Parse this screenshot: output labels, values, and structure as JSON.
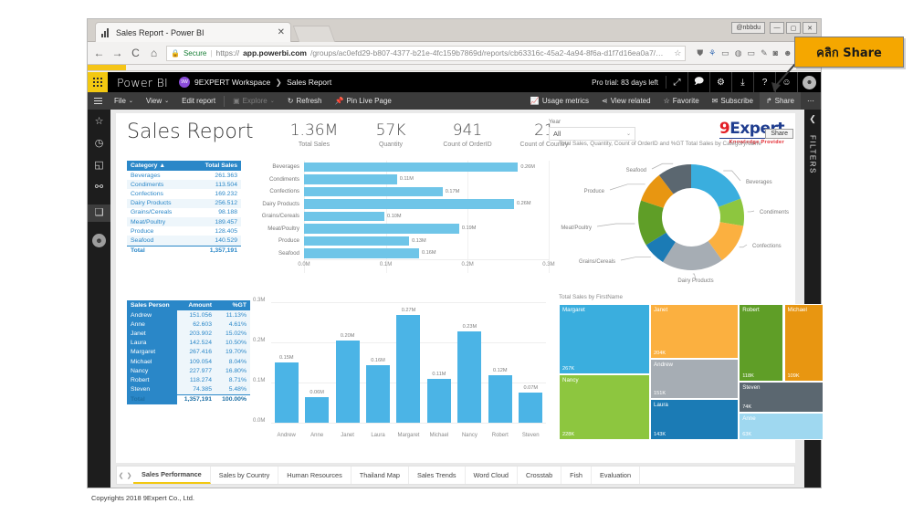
{
  "browser": {
    "tab_title": "Sales Report - Power BI",
    "tab_close": "✕",
    "nav": {
      "back": "←",
      "forward": "→",
      "reload": "C",
      "home": "⌂"
    },
    "secure_label": "Secure",
    "url_scheme": "https://",
    "url_host": "app.powerbi.com",
    "url_path": "/groups/ac0efd29-b807-4377-b21e-4fc159b7869d/reports/cb63316c-45a2-4a94-8f6a-d1f7d16ea0a7/ReportSe...",
    "star": "☆",
    "window_user": "@nbbdu",
    "win_min": "—",
    "win_max": "▢",
    "win_close": "✕"
  },
  "pbi_header": {
    "brand": "Power BI",
    "workspace_initials": "9W",
    "workspace": "9EXPERT Workspace",
    "separator": "❯",
    "report_name": "Sales Report",
    "trial_text": "Pro trial: 83 days left",
    "icons": {
      "expand": "⤢",
      "feedback": "🗩",
      "settings": "⚙",
      "download": "⤓",
      "help": "?",
      "smiley": "☺",
      "account": "◕"
    }
  },
  "command_bar": {
    "file": "File",
    "view": "View",
    "edit_report": "Edit report",
    "explore": "Explore",
    "refresh": "Refresh",
    "pin_live_page": "Pin Live Page",
    "usage_metrics": "Usage metrics",
    "view_related": "View related",
    "favorite": "Favorite",
    "subscribe": "Subscribe",
    "share": "Share",
    "more": "⋯",
    "caret": "⌄"
  },
  "left_rail": {
    "favorites_icon": "☆",
    "recent_icon": "◷",
    "apps_icon": "◱",
    "shared_icon": "⚯",
    "workspaces_icon": "❑",
    "avatar_icon": "☻"
  },
  "right_rail": {
    "collapse": "❮",
    "filters_label": "FILTERS"
  },
  "share_tooltip": "Share",
  "callout": {
    "text": "คลิก  Share"
  },
  "report": {
    "title": "Sales Report",
    "kpis": [
      {
        "value": "1.36M",
        "label": "Total Sales"
      },
      {
        "value": "57K",
        "label": "Quantity"
      },
      {
        "value": "941",
        "label": "Count of OrderID"
      },
      {
        "value": "21",
        "label": "Count of Country"
      }
    ],
    "slicer": {
      "label": "Year",
      "value": "All",
      "chevron": "⌄"
    },
    "logo": {
      "nine": "9",
      "expert": "Expert",
      "tagline": "Knowledge Provider"
    }
  },
  "category_table": {
    "sort_arrow": "▲",
    "headers": [
      "Category",
      "Total Sales"
    ],
    "rows": [
      [
        "Beverages",
        "261.363"
      ],
      [
        "Condiments",
        "113.504"
      ],
      [
        "Confections",
        "169.232"
      ],
      [
        "Dairy Products",
        "256.512"
      ],
      [
        "Grains/Cereals",
        "98.188"
      ],
      [
        "Meat/Poultry",
        "189.457"
      ],
      [
        "Produce",
        "128.405"
      ],
      [
        "Seafood",
        "140.529"
      ]
    ],
    "total": [
      "Total",
      "1,357,191"
    ]
  },
  "salesperson_table": {
    "headers": [
      "Sales Person",
      "Amount",
      "%GT"
    ],
    "rows": [
      [
        "Andrew",
        "151.056",
        "11.13%"
      ],
      [
        "Anne",
        "62.603",
        "4.61%"
      ],
      [
        "Janet",
        "203.902",
        "15.02%"
      ],
      [
        "Laura",
        "142.524",
        "10.50%"
      ],
      [
        "Margaret",
        "267.416",
        "19.70%"
      ],
      [
        "Michael",
        "109.054",
        "8.04%"
      ],
      [
        "Nancy",
        "227.977",
        "16.80%"
      ],
      [
        "Robert",
        "118.274",
        "8.71%"
      ],
      [
        "Steven",
        "74.385",
        "5.48%"
      ]
    ],
    "total": [
      "Total",
      "1,357,191",
      "100.00%"
    ]
  },
  "page_tabs": {
    "prev": "❮",
    "next": "❯",
    "items": [
      "Sales Performance",
      "Sales by Country",
      "Human Resources",
      "Thailand Map",
      "Sales Trends",
      "Word Cloud",
      "Crosstab",
      "Fish",
      "Evaluation"
    ],
    "active": "Sales Performance"
  },
  "copyright": "Copyrights 2018 9Expert Co., Ltd.",
  "chart_data": [
    {
      "type": "bar",
      "orientation": "horizontal",
      "title": "",
      "categories": [
        "Beverages",
        "Condiments",
        "Confections",
        "Dairy Products",
        "Grains/Cereals",
        "Meat/Poultry",
        "Produce",
        "Seafood"
      ],
      "values": [
        0.261363,
        0.113504,
        0.169232,
        0.256512,
        0.098188,
        0.189457,
        0.128405,
        0.140529
      ],
      "data_labels": [
        "0.26M",
        "0.11M",
        "0.17M",
        "0.26M",
        "0.10M",
        "0.19M",
        "0.13M",
        "0.16M"
      ],
      "xlabel": "",
      "ylabel": "",
      "xticks": [
        "0.0M",
        "0.1M",
        "0.2M",
        "0.3M"
      ],
      "xlim": [
        0,
        0.3
      ],
      "grid": true,
      "color": "#6fc5e8"
    },
    {
      "type": "pie",
      "subtype": "donut",
      "title": "Total Sales, Quantity, Count of OrderID and %GT Total Sales by CategoryName",
      "labels": [
        "Beverages",
        "Condiments",
        "Confections",
        "Dairy Products",
        "Grains/Cereals",
        "Meat/Poultry",
        "Produce",
        "Seafood"
      ],
      "values": [
        261363,
        113504,
        169232,
        256512,
        98188,
        189457,
        128405,
        140529
      ],
      "colors": [
        "#3aaede",
        "#8dc63f",
        "#fbb040",
        "#a6adb4",
        "#1b7bb5",
        "#5f9e27",
        "#e89611",
        "#5b6770"
      ],
      "legend": "labels-with-leader-lines"
    },
    {
      "type": "bar",
      "orientation": "vertical",
      "title": "",
      "categories": [
        "Andrew",
        "Anne",
        "Janet",
        "Laura",
        "Margaret",
        "Michael",
        "Nancy",
        "Robert",
        "Steven"
      ],
      "values": [
        0.151056,
        0.062603,
        0.203902,
        0.142524,
        0.267416,
        0.109054,
        0.227977,
        0.118274,
        0.074385
      ],
      "data_labels": [
        "0.15M",
        "0.06M",
        "0.20M",
        "0.16M",
        "0.27M",
        "0.11M",
        "0.23M",
        "0.12M",
        "0.07M"
      ],
      "yticks": [
        "0.0M",
        "0.1M",
        "0.2M",
        "0.3M"
      ],
      "ylim": [
        0,
        0.3
      ],
      "grid": true,
      "color": "#4bb4e6"
    },
    {
      "type": "treemap",
      "title": "Total Sales by FirstName",
      "labels": [
        "Margaret",
        "Nancy",
        "Janet",
        "Andrew",
        "Laura",
        "Robert",
        "Michael",
        "Steven",
        "Anne"
      ],
      "values": [
        267416,
        227977,
        203902,
        151056,
        142524,
        118274,
        109054,
        74385,
        62603
      ],
      "data_labels": [
        "267K",
        "228K",
        "204K",
        "151K",
        "143K",
        "118K",
        "109K",
        "74K",
        "63K"
      ],
      "colors": [
        "#3aaede",
        "#8dc63f",
        "#fbb040",
        "#a6adb4",
        "#1b7bb5",
        "#5f9e27",
        "#e89611",
        "#5b6770",
        "#9fd8f0"
      ]
    }
  ]
}
